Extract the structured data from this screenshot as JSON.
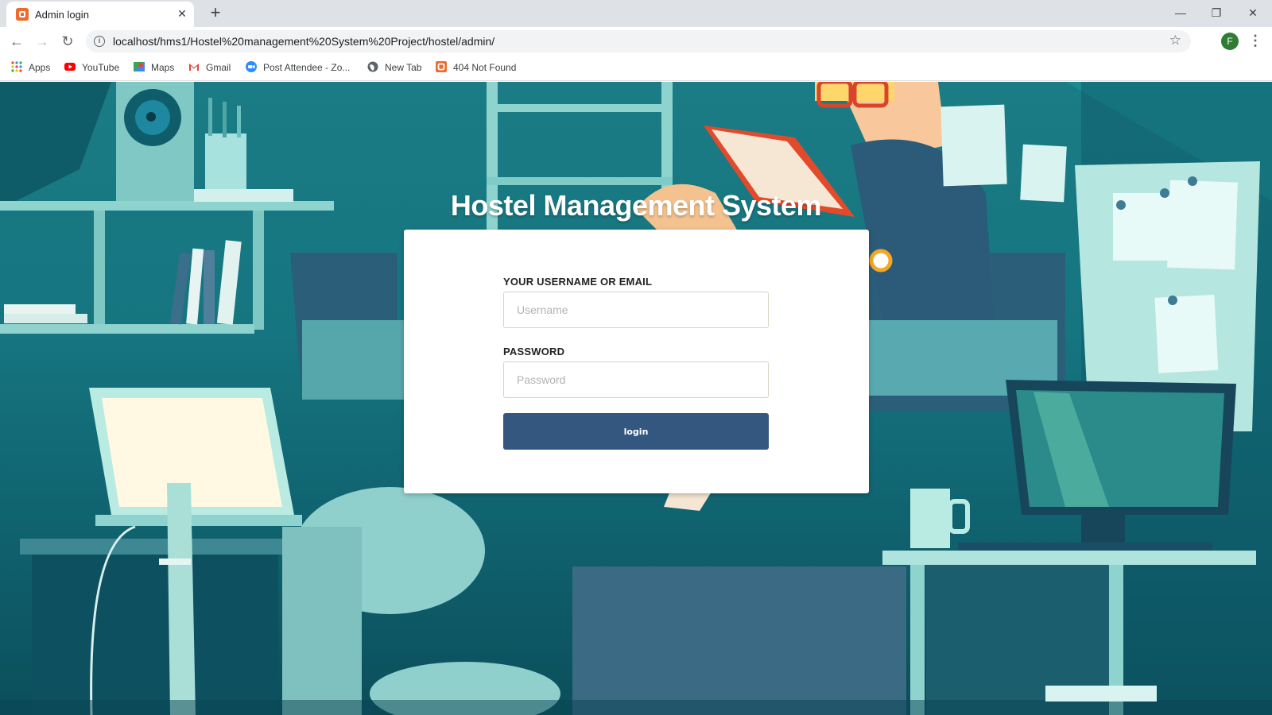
{
  "browser": {
    "tab_title": "Admin login",
    "tab_favicon": "xampp-icon",
    "url": "localhost/hms1/Hostel%20management%20System%20Project/hostel/admin/",
    "profile_initial": "F",
    "bookmarks": [
      {
        "label": "Apps",
        "icon": "apps-grid-icon"
      },
      {
        "label": "YouTube",
        "icon": "youtube-icon"
      },
      {
        "label": "Maps",
        "icon": "maps-icon"
      },
      {
        "label": "Gmail",
        "icon": "gmail-icon"
      },
      {
        "label": "Post Attendee - Zo...",
        "icon": "zoom-icon"
      },
      {
        "label": "New Tab",
        "icon": "globe-icon"
      },
      {
        "label": "404 Not Found",
        "icon": "xampp-icon"
      }
    ]
  },
  "page": {
    "heading": "Hostel Management System",
    "username_label": "YOUR USERNAME OR EMAIL",
    "username_placeholder": "Username",
    "password_label": "PASSWORD",
    "password_placeholder": "Password",
    "login_button": "login"
  },
  "colors": {
    "accent_button": "#34577f",
    "scene_teal": "#157580"
  }
}
